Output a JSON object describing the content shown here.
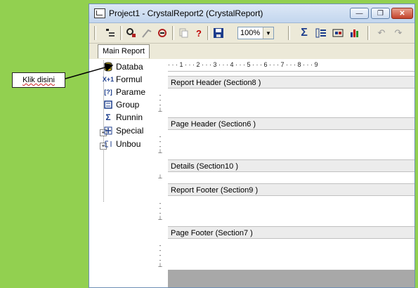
{
  "window": {
    "title": "Project1 - CrystalReport2 (CrystalReport)",
    "minimize_label": "—",
    "restore_label": "❐",
    "close_label": "✕"
  },
  "toolbar": {
    "zoom_value": "100%",
    "sum_icon": "Σ",
    "help_icon": "?"
  },
  "tabs": [
    {
      "label": "Main Report"
    }
  ],
  "tree": {
    "items": [
      {
        "label": "Databa",
        "icon": "database-icon"
      },
      {
        "label": "Formul",
        "icon": "formula-icon"
      },
      {
        "label": "Parame",
        "icon": "parameter-icon"
      },
      {
        "label": "Group",
        "icon": "group-icon"
      },
      {
        "label": "Runnin",
        "icon": "running-total-icon"
      },
      {
        "label": "Special",
        "icon": "special-field-icon"
      },
      {
        "label": "Unbou",
        "icon": "unbound-field-icon"
      }
    ],
    "formula_glyph": "X+1",
    "parameter_glyph": "[?]"
  },
  "ruler": {
    "text": "· · · 1 · · · 2 · · · 3 · · · 4 · · · 5 · · · 6 · · · 7 · · · 8 · · · 9"
  },
  "sections": [
    {
      "label": "Report Header  (Section8 )"
    },
    {
      "label": "Page Header  (Section6 )"
    },
    {
      "label": "Details  (Section10 )"
    },
    {
      "label": "Report Footer  (Section9 )"
    },
    {
      "label": "Page Footer  (Section7 )"
    }
  ],
  "callout": {
    "text": "Klik disini"
  }
}
